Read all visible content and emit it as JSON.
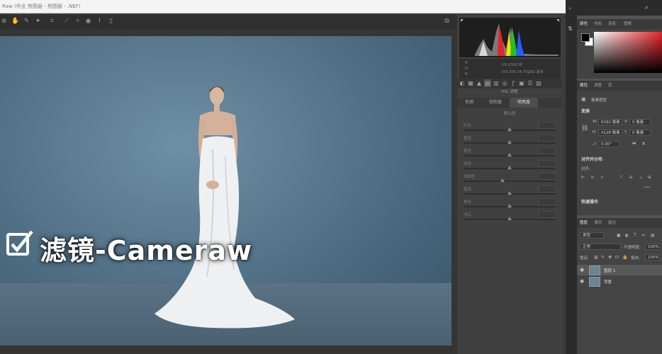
{
  "camera_raw": {
    "title": "Raw (作业 剪图层 - 剪图层 - .NEF)",
    "histogram_info": {
      "left_top": "R:",
      "left_mid": "G:",
      "left_bot": "B:",
      "right_top": "f/9   1/160 秒",
      "right_bot": "ISO 200   24-70@62 毫米"
    },
    "panel_title": "HSL 调整",
    "hsl_tabs": [
      "色相",
      "饱和度",
      "明亮度"
    ],
    "hsl_active_tab": 2,
    "hsl_subtitle": "默认值",
    "hsl_rows": [
      {
        "label": "红色",
        "position": 0.5
      },
      {
        "label": "橙色",
        "position": 0.5
      },
      {
        "label": "黄色",
        "position": 0.5
      },
      {
        "label": "绿色",
        "position": 0.5
      },
      {
        "label": "浅绿色",
        "position": 0.42
      },
      {
        "label": "蓝色",
        "position": 0.5
      },
      {
        "label": "紫色",
        "position": 0.5
      },
      {
        "label": "洋红",
        "position": 0.5
      }
    ],
    "overlay_caption": "滤镜-Cameraw"
  },
  "photoshop": {
    "color_tabs": [
      "颜色",
      "色板",
      "渐变",
      "图案"
    ],
    "props_tabs": [
      "属性",
      "调整",
      "库"
    ],
    "props_layer_type": "像素图层",
    "transform_title": "变换",
    "width": "6192 像素",
    "height": "4128 像素",
    "x": "0 像素",
    "y": "0 像素",
    "angle": "0.00°",
    "align_title": "对齐并分布",
    "align_label": "对齐:",
    "quick_title": "快速操作",
    "layers_tabs": [
      "图层",
      "通道",
      "路径"
    ],
    "kind_label": "类型",
    "blend_mode": "正常",
    "opacity_label": "不透明度:",
    "opacity_value": "100%",
    "lock_label": "锁定:",
    "fill_label": "填充:",
    "fill_value": "100%",
    "layers": [
      {
        "name": "图层 1",
        "selected": true
      },
      {
        "name": "背景",
        "selected": false
      }
    ]
  }
}
